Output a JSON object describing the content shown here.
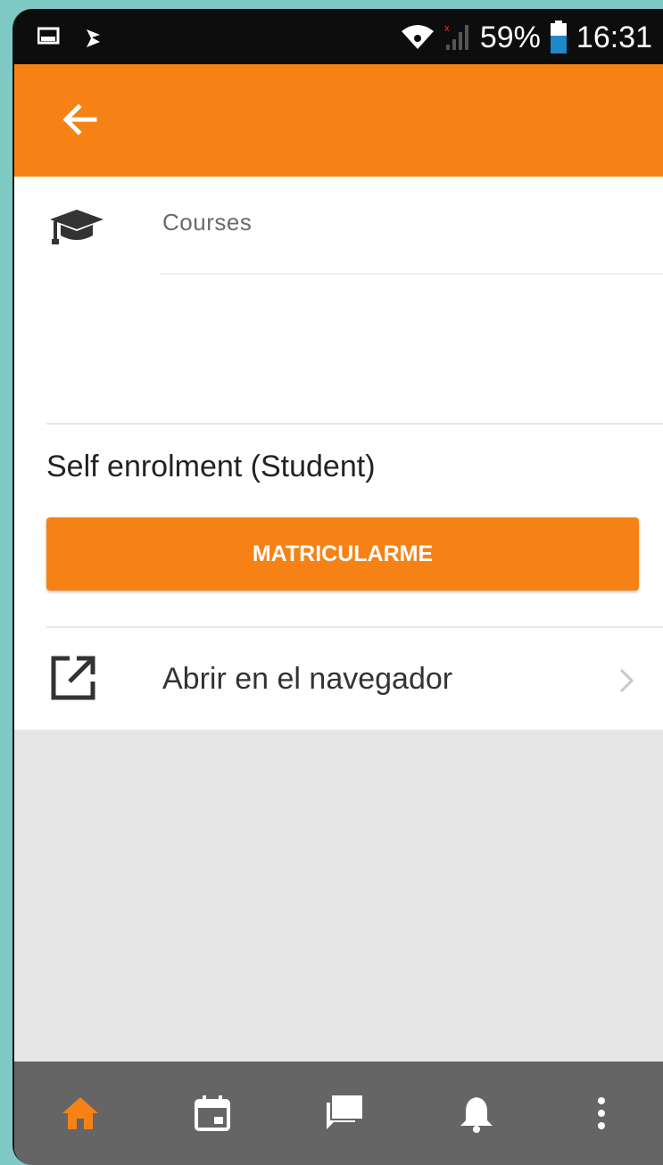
{
  "status_bar": {
    "battery": "59%",
    "time": "16:31",
    "icons": [
      "gallery-notification-icon",
      "download-notification-icon",
      "wifi-icon",
      "signal-icon",
      "battery-icon"
    ]
  },
  "app_bar": {
    "back_icon": "arrow-back-icon"
  },
  "course": {
    "category": "Courses",
    "icon": "graduation-cap-icon"
  },
  "enrolment": {
    "title": "Self enrolment (Student)",
    "button_label": "MATRICULARME"
  },
  "open_in_browser": {
    "label": "Abrir en el navegador",
    "icon": "open-external-icon"
  },
  "bottom_nav": {
    "items": [
      "home-icon",
      "calendar-icon",
      "messages-icon",
      "notifications-icon",
      "more-icon"
    ],
    "active": "home-icon"
  },
  "colors": {
    "accent": "#f68216",
    "nav_background": "#656565",
    "nav_inactive": "#ffffff"
  }
}
